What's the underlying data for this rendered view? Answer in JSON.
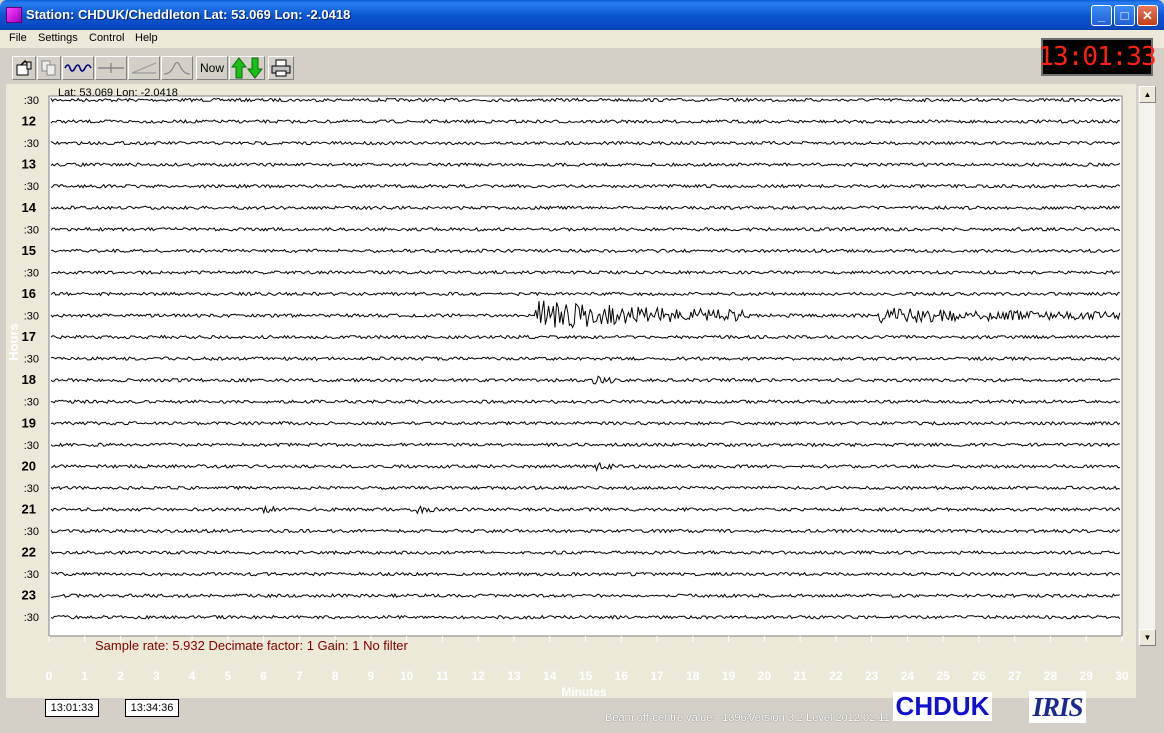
{
  "window": {
    "title": "Station: CHDUK/Cheddleton Lat: 53.069 Lon: -2.0418",
    "minimize": "_",
    "maximize": "□",
    "close": "✕"
  },
  "menu": [
    "File",
    "Settings",
    "Control",
    "Help"
  ],
  "toolbar": {
    "now_label": "Now",
    "icons": [
      "open-icon",
      "copy-icon",
      "waveform-icon",
      "flatline-icon",
      "slope-icon",
      "pulse-icon",
      "now-button",
      "up-down-arrows-icon",
      "printer-icon"
    ]
  },
  "clock": "13:01:33",
  "helicorder": {
    "caption": "Lat: 53.069 Lon: -2.0418",
    "y_axis_label": "Hours",
    "row_labels": [
      ":30",
      "12",
      ":30",
      "13",
      ":30",
      "14",
      ":30",
      "15",
      ":30",
      "16",
      ":30",
      "17",
      ":30",
      "18",
      ":30",
      "19",
      ":30",
      "20",
      ":30",
      "21",
      ":30",
      "22",
      ":30",
      "23",
      ":30"
    ],
    "x_axis_label": "Minutes",
    "x_ticks": [
      "0",
      "1",
      "2",
      "3",
      "4",
      "5",
      "6",
      "7",
      "8",
      "9",
      "10",
      "11",
      "12",
      "13",
      "14",
      "15",
      "16",
      "17",
      "18",
      "19",
      "20",
      "21",
      "22",
      "23",
      "24",
      "25",
      "26",
      "27",
      "28",
      "29",
      "30"
    ],
    "trace_color": "#000000",
    "background_color": "#ffffff",
    "events": [
      {
        "row": 10,
        "minute": 13.6,
        "strength": 14,
        "duration_min": 6
      },
      {
        "row": 10,
        "minute": 23.2,
        "strength": 7,
        "duration_min": 6.8
      },
      {
        "row": 13,
        "minute": 15.2,
        "strength": 4,
        "duration_min": 0.6
      },
      {
        "row": 17,
        "minute": 15.3,
        "strength": 3,
        "duration_min": 0.5
      },
      {
        "row": 19,
        "minute": 5.8,
        "strength": 3,
        "duration_min": 0.6
      },
      {
        "row": 19,
        "minute": 10.3,
        "strength": 3,
        "duration_min": 0.6
      }
    ]
  },
  "status": {
    "sample_info": "Sample rate: 5.932  Decimate factor: 1  Gain: 1  No filter",
    "time_start": "13:01:33",
    "time_end": "13:34:36",
    "beam": "Beam off-centre value: -13964",
    "version": "Version 3.2 Level 2012.02.11",
    "station_logo": "CHDUK",
    "iris_logo": "IRIS"
  }
}
